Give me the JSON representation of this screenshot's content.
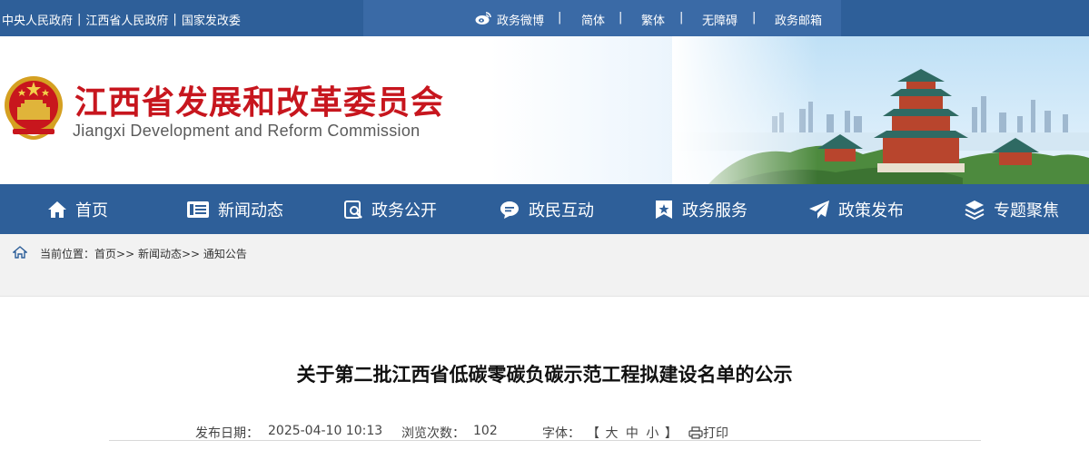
{
  "topbar": {
    "links": [
      "中央人民政府",
      "江西省人民政府",
      "国家发改委"
    ],
    "separator": "|",
    "weibo": "政务微博",
    "simplified": "简体",
    "traditional": "繁体",
    "accessibility": "无障碍",
    "mailbox": "政务邮箱",
    "bar": "|"
  },
  "banner": {
    "title_cn": "江西省发展和改革委员会",
    "title_en": "Jiangxi Development and Reform Commission"
  },
  "nav": {
    "items": [
      {
        "label": "首页",
        "icon": "home-icon"
      },
      {
        "label": "新闻动态",
        "icon": "news-icon"
      },
      {
        "label": "政务公开",
        "icon": "open-gov-icon"
      },
      {
        "label": "政民互动",
        "icon": "chat-icon"
      },
      {
        "label": "政务服务",
        "icon": "service-icon"
      },
      {
        "label": "政策发布",
        "icon": "send-icon"
      },
      {
        "label": "专题聚焦",
        "icon": "layers-icon"
      }
    ]
  },
  "breadcrumb": {
    "prefix": "当前位置：",
    "items": [
      "首页",
      "新闻动态",
      "通知公告"
    ],
    "sep": ">>"
  },
  "article": {
    "title": "关于第二批江西省低碳零碳负碳示范工程拟建设名单的公示",
    "date_label": "发布日期：",
    "date": "2025-04-10 10:13",
    "views_label": "浏览次数：",
    "views": "102",
    "font_label": "字体：",
    "font_open": "【",
    "font_large": "大",
    "font_medium": "中",
    "font_small": "小",
    "font_close": "】",
    "print": "打印"
  },
  "colors": {
    "nav_bg": "#2e5f99",
    "title_red": "#c7161e"
  }
}
